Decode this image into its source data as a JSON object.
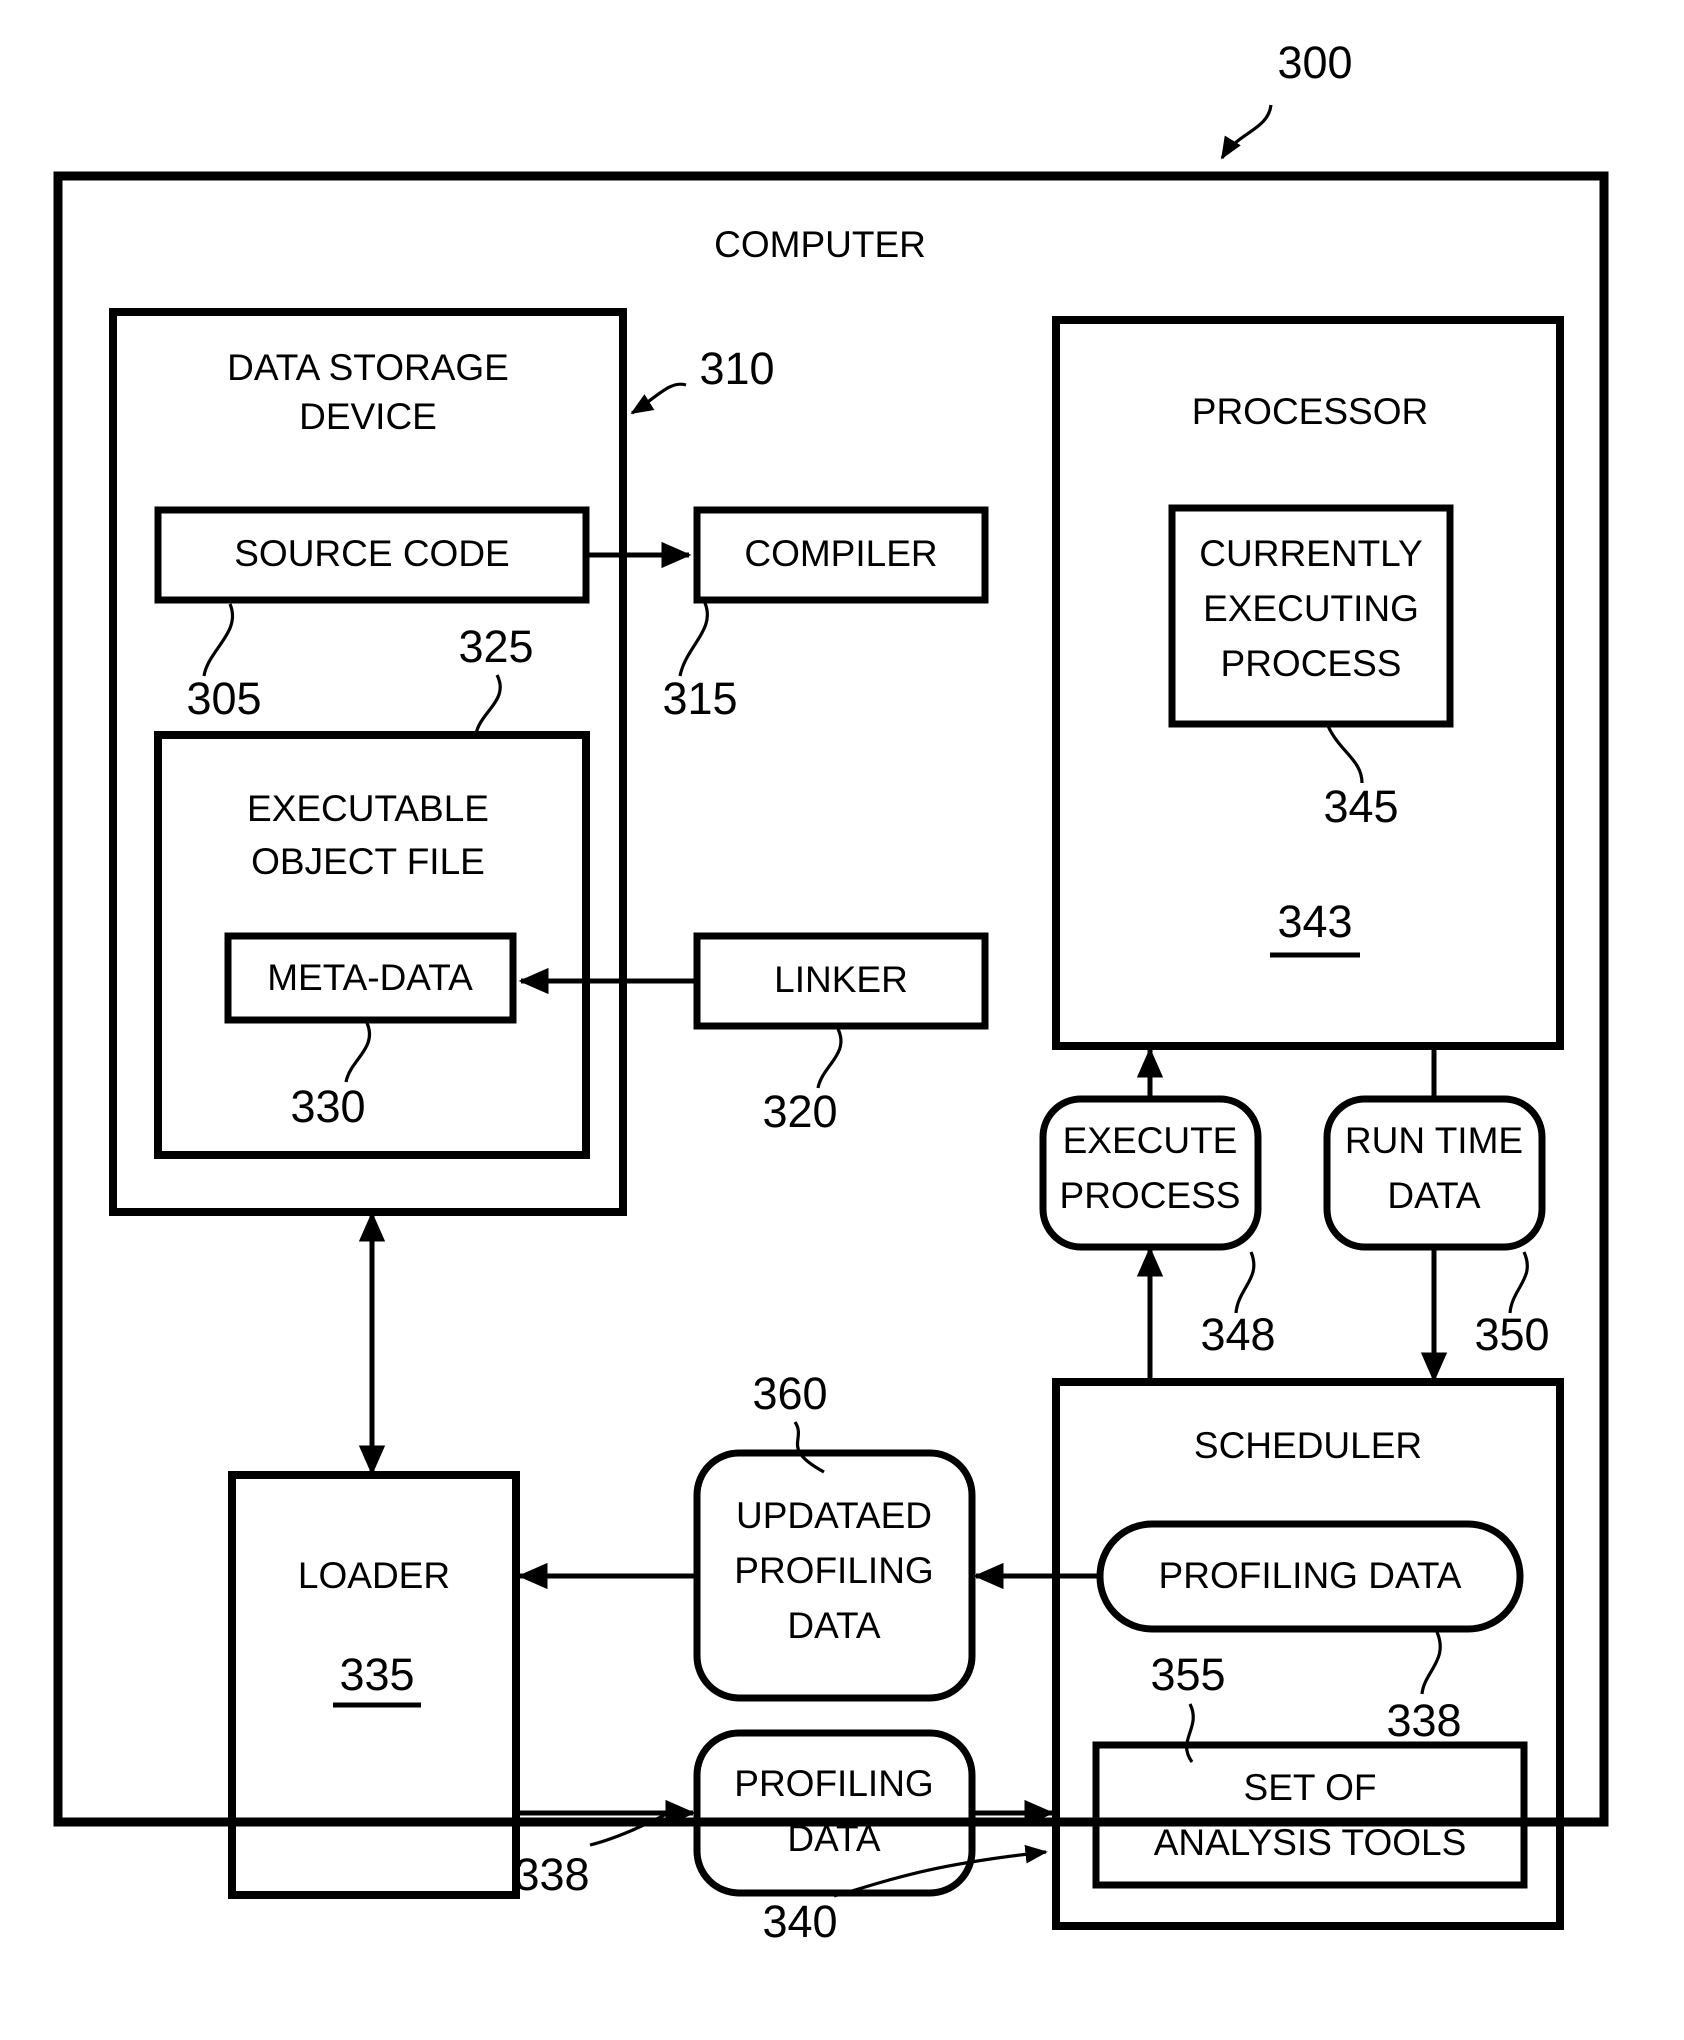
{
  "figure": {
    "figure_number": "300",
    "outer_container_label": "COMPUTER"
  },
  "blocks": {
    "data_storage_device": {
      "label": "DATA STORAGE\nDEVICE",
      "line1": "DATA STORAGE",
      "line2": "DEVICE",
      "ref": "310"
    },
    "source_code": {
      "label": "SOURCE CODE",
      "ref": "305"
    },
    "compiler": {
      "label": "COMPILER",
      "ref": "315"
    },
    "executable_object_file": {
      "line1": "EXECUTABLE",
      "line2": "OBJECT FILE",
      "ref": "325"
    },
    "meta_data": {
      "label": "META-DATA",
      "ref": "330"
    },
    "linker": {
      "label": "LINKER",
      "ref": "320"
    },
    "processor": {
      "label": "PROCESSOR",
      "ref": "343"
    },
    "currently_executing_process": {
      "line1": "CURRENTLY",
      "line2": "EXECUTING",
      "line3": "PROCESS",
      "ref": "345"
    },
    "execute_process": {
      "line1": "EXECUTE",
      "line2": "PROCESS",
      "ref": "348"
    },
    "run_time_data": {
      "line1": "RUN TIME",
      "line2": "DATA",
      "ref": "350"
    },
    "scheduler": {
      "label": "SCHEDULER",
      "ref": "340"
    },
    "scheduler_profiling_data": {
      "label": "PROFILING DATA",
      "ref": "338"
    },
    "set_of_analysis_tools": {
      "line1": "SET OF",
      "line2": "ANALYSIS TOOLS",
      "ref": "355"
    },
    "loader": {
      "label": "LOADER",
      "ref": "335"
    },
    "updated_profiling_data": {
      "line1": "UPDATAED",
      "line2": "PROFILING",
      "line3": "DATA",
      "ref": "360"
    },
    "loader_profiling_data": {
      "line1": "PROFILING",
      "line2": "DATA",
      "ref": "338"
    }
  },
  "colors": {
    "stroke": "#000000",
    "background": "#ffffff"
  }
}
